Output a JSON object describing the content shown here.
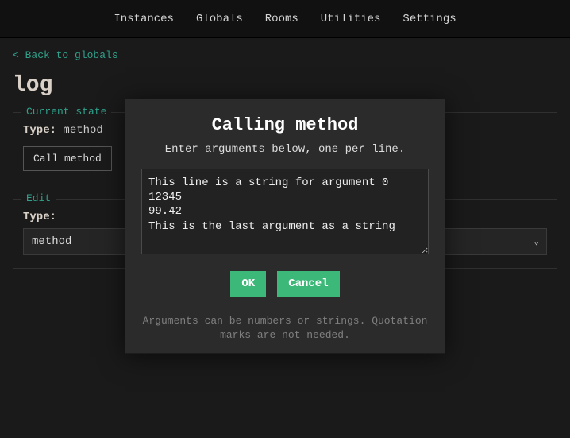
{
  "nav": {
    "items": [
      "Instances",
      "Globals",
      "Rooms",
      "Utilities",
      "Settings"
    ]
  },
  "backlink": "Back to globals",
  "page_title": "log",
  "panel_state": {
    "legend": "Current state",
    "type_label": "Type:",
    "type_value": "method",
    "call_button": "Call method"
  },
  "panel_edit": {
    "legend": "Edit",
    "type_label": "Type:",
    "select_value": "method"
  },
  "modal": {
    "title": "Calling method",
    "instruction": "Enter arguments below, one per line.",
    "textarea_value": "This line is a string for argument 0\n12345\n99.42\nThis is the last argument as a string",
    "ok": "OK",
    "cancel": "Cancel",
    "footnote": "Arguments can be numbers or strings. Quotation marks are not needed."
  }
}
